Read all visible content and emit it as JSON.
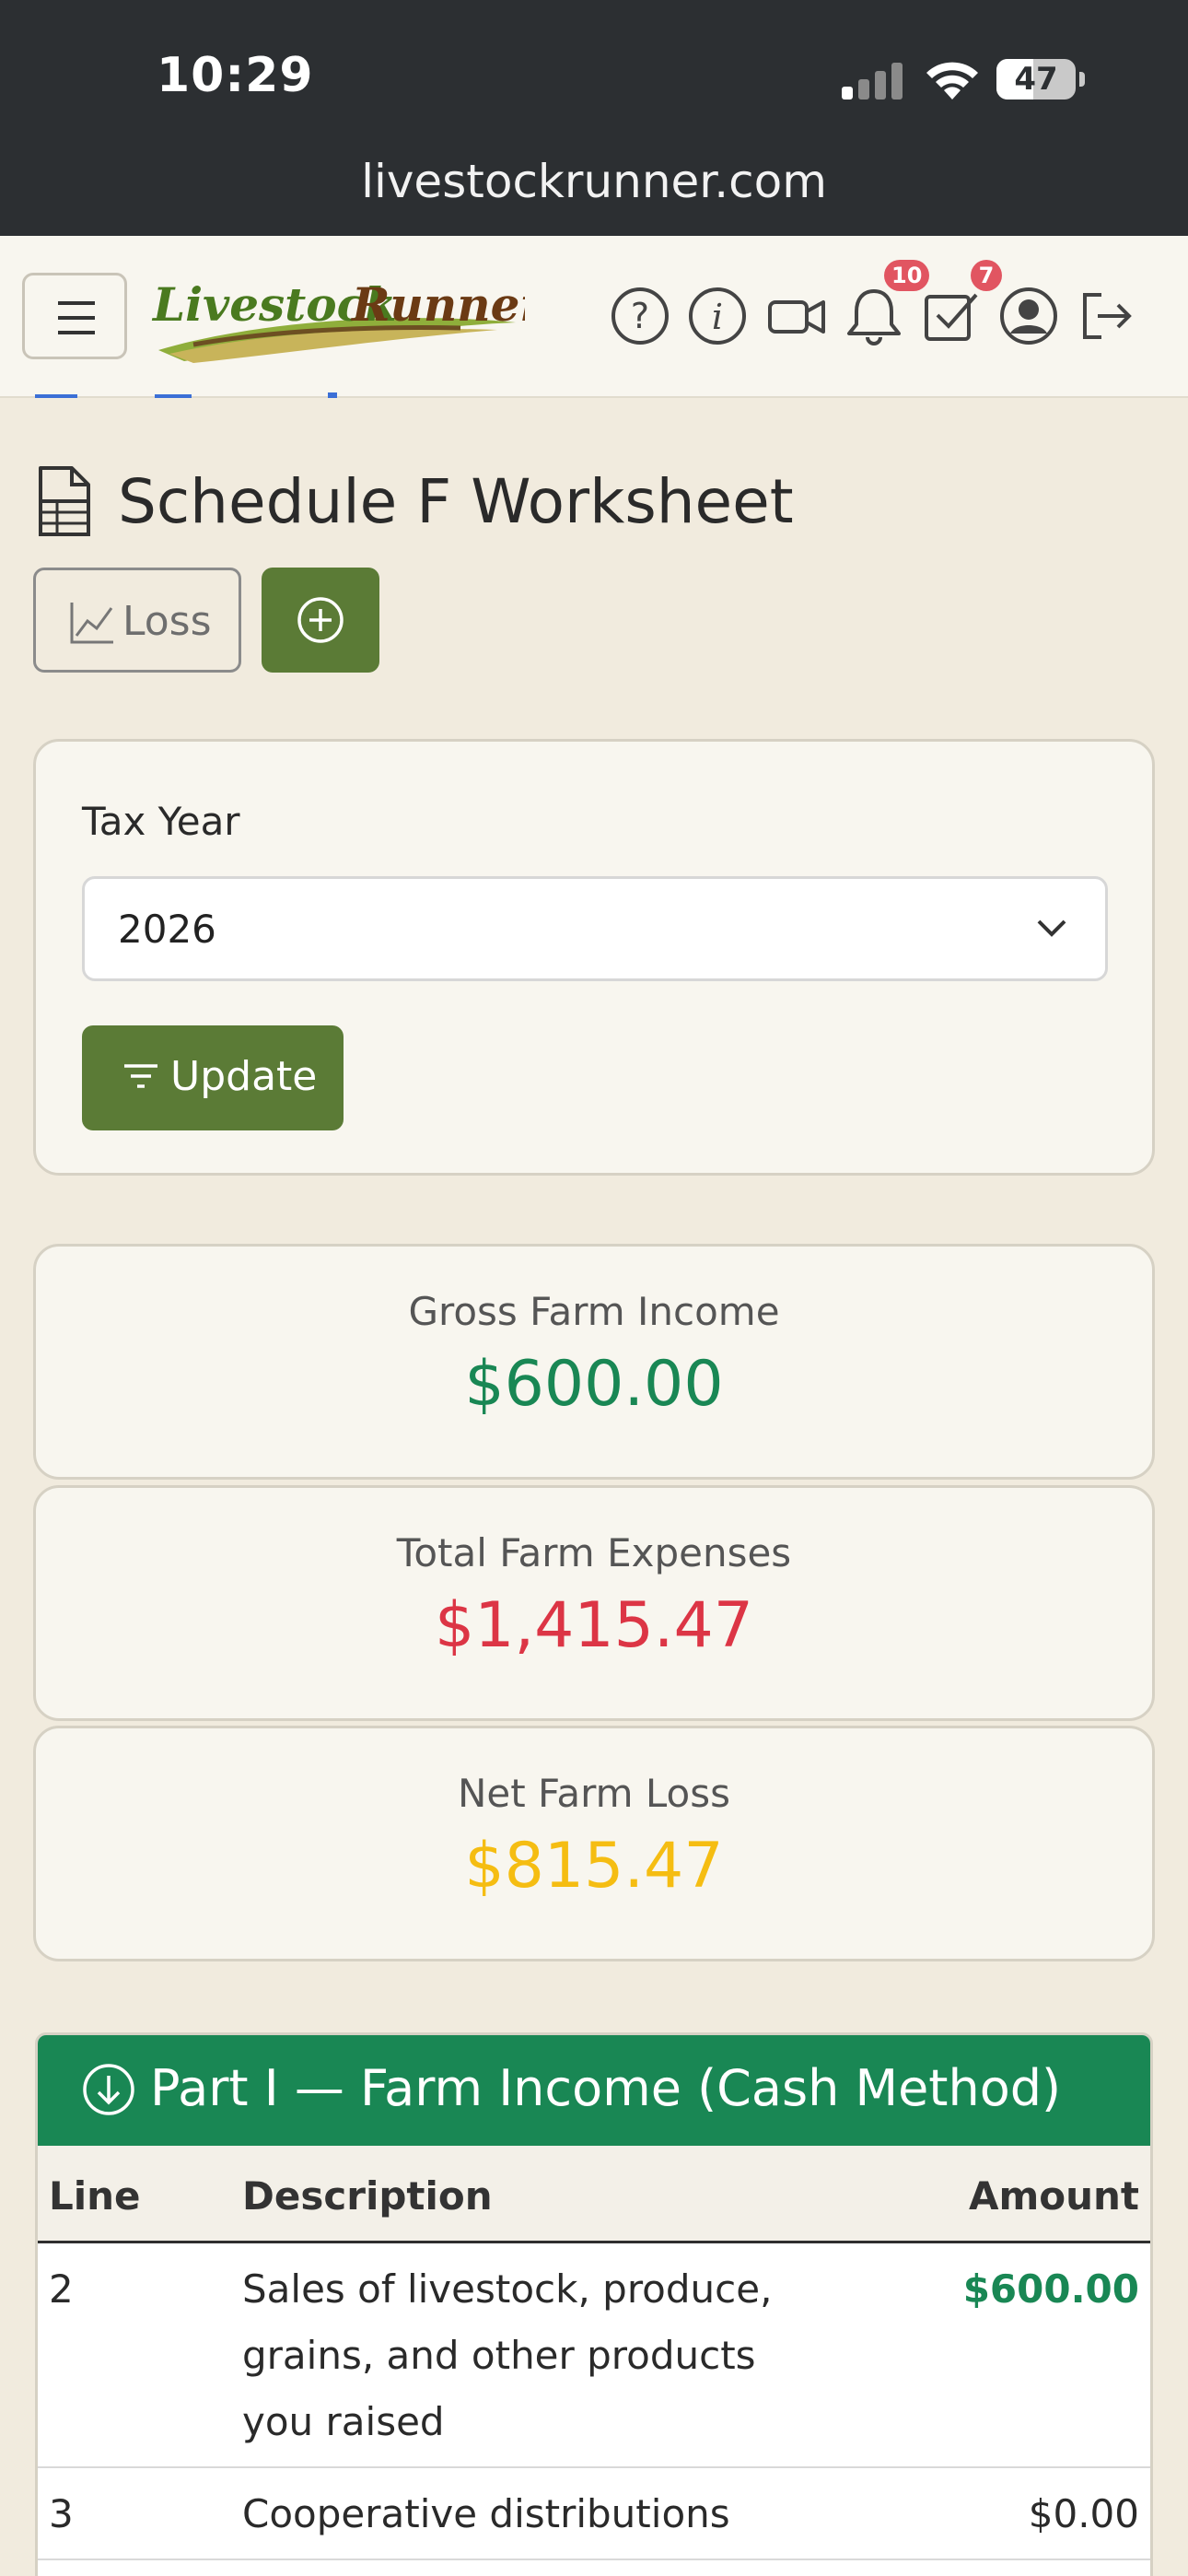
{
  "status_bar": {
    "time": "10:29",
    "battery": "47",
    "battery_level_percent": 47
  },
  "browser": {
    "url": "livestockrunner.com"
  },
  "navbar": {
    "logo_text": "LivestockRunner",
    "icons": [
      "menu-icon",
      "help-circle-icon",
      "info-icon",
      "video-icon",
      "bell-icon",
      "tasks-checkbox-icon",
      "user-profile-icon",
      "logout-icon"
    ],
    "notifications_count": "10",
    "tasks_count": "7"
  },
  "page": {
    "title": "Schedule F Worksheet",
    "loss_button": "Loss",
    "filter": {
      "label": "Tax Year",
      "selected_year": "2026",
      "update_button": "Update"
    },
    "summary": {
      "gross_income_label": "Gross Farm Income",
      "gross_income_value": "$600.00",
      "expenses_label": "Total Farm Expenses",
      "expenses_value": "$1,415.47",
      "net_label": "Net Farm Loss",
      "net_value": "$815.47"
    },
    "colors": {
      "income": "#198754",
      "expenses": "#dc3545",
      "net": "#f5bd12",
      "primary_button": "#5b7b36"
    },
    "part1": {
      "title": "Part I — Farm Income (Cash Method)",
      "columns": {
        "line": "Line",
        "description": "Description",
        "amount": "Amount"
      },
      "rows": [
        {
          "line": "2",
          "description": "Sales of livestock, produce, grains, and other products you raised",
          "amount": "$600.00"
        },
        {
          "line": "3",
          "description": "Cooperative distributions",
          "amount": "$0.00"
        }
      ]
    }
  }
}
